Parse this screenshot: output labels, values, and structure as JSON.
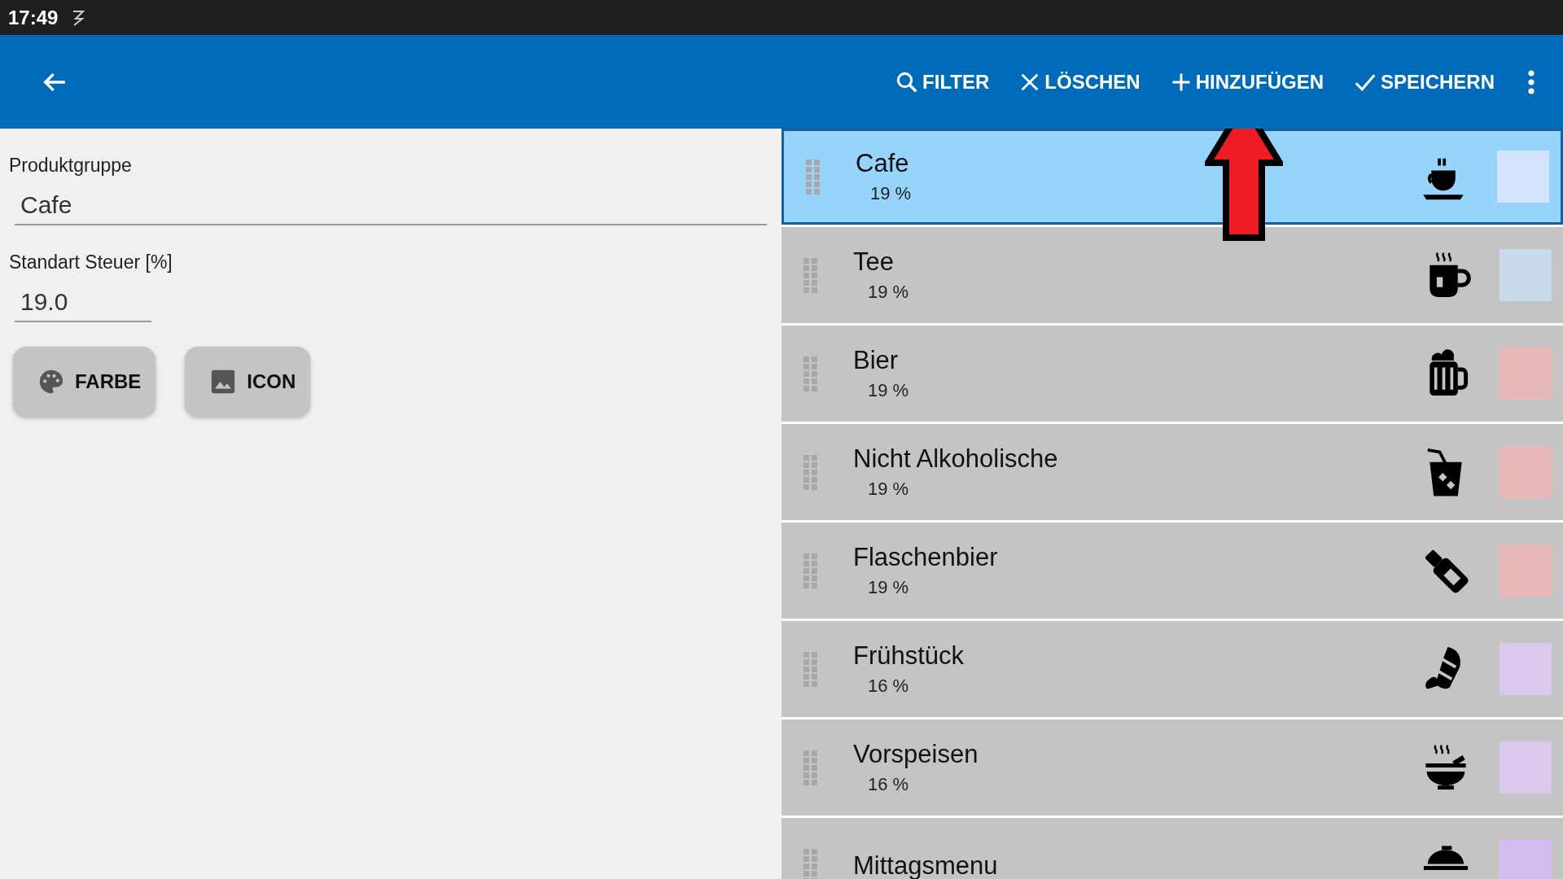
{
  "status_bar": {
    "time": "17:49"
  },
  "app_bar": {
    "actions": [
      {
        "label": "FILTER",
        "kind": "search"
      },
      {
        "label": "LÖSCHEN",
        "kind": "close"
      },
      {
        "label": "HINZUFÜGEN",
        "kind": "add"
      },
      {
        "label": "SPEICHERN",
        "kind": "check"
      }
    ]
  },
  "form": {
    "fields": [
      {
        "label": "Produktgruppe",
        "value": "Cafe",
        "kind": "wide"
      },
      {
        "label": "Standart Steuer [%]",
        "value": "19.0",
        "kind": "narrow"
      }
    ],
    "buttons": [
      {
        "label": "FARBE",
        "kind": "palette"
      },
      {
        "label": "ICON",
        "kind": "image"
      }
    ]
  },
  "groups": [
    {
      "name": "Cafe",
      "tax": "19 %",
      "color": "#d3e3fd",
      "selected": true
    },
    {
      "name": "Tee",
      "tax": "19 %",
      "color": "#c8daec",
      "selected": false
    },
    {
      "name": "Bier",
      "tax": "19 %",
      "color": "#e8b8b8",
      "selected": false
    },
    {
      "name": "Nicht Alkoholische",
      "tax": "19 %",
      "color": "#e8b8b8",
      "selected": false
    },
    {
      "name": "Flaschenbier",
      "tax": "19 %",
      "color": "#e8b8b8",
      "selected": false
    },
    {
      "name": "Frühstück",
      "tax": "16 %",
      "color": "#dcc8ec",
      "selected": false
    },
    {
      "name": "Vorspeisen",
      "tax": "16 %",
      "color": "#dcc8ec",
      "selected": false
    },
    {
      "name": "Mittagsmenu",
      "color": "#d4bdf0",
      "selected": false
    }
  ]
}
